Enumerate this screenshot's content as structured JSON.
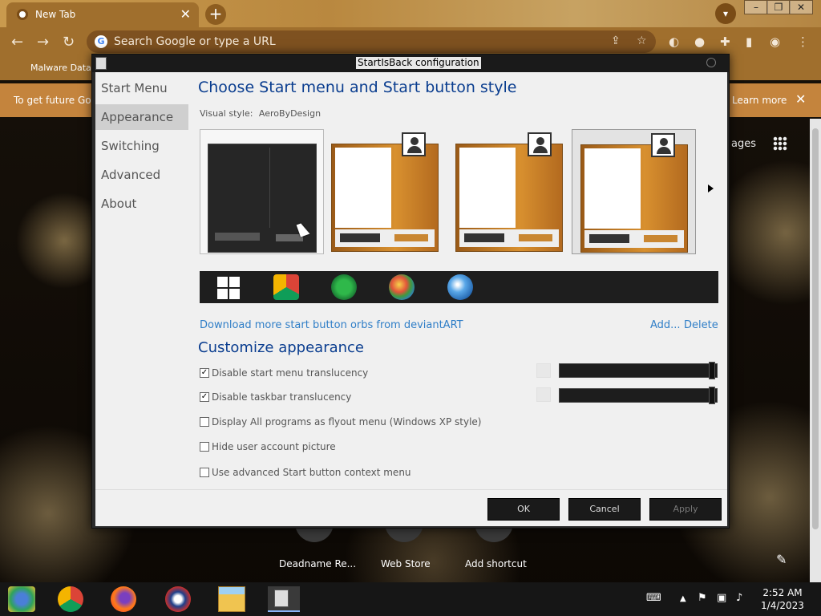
{
  "browser": {
    "tab_title": "New Tab",
    "tab_close": "✕",
    "new_tab": "+",
    "omnibox_placeholder": "Search Google or type a URL",
    "bookmark": "Malware Datab",
    "infobar_message": "To get future Go",
    "infobar_learn_more": "Learn more",
    "infobar_close": "✕",
    "ntp_link": "ages",
    "shortcuts": [
      "Deadname Re...",
      "Web Store",
      "Add shortcut"
    ]
  },
  "dialog": {
    "title": "StartIsBack configuration",
    "nav": [
      "Start Menu",
      "Appearance",
      "Switching",
      "Advanced",
      "About"
    ],
    "selected_nav": "Appearance",
    "heading_style": "Choose Start menu and Start button style",
    "visual_style_label": "Visual style:",
    "visual_style_value": "AeroByDesign",
    "download_link": "Download more start button orbs from deviantART",
    "add_link": "Add...",
    "delete_link": "Delete",
    "heading_customize": "Customize appearance",
    "options": [
      {
        "label": "Disable start menu translucency",
        "checked": true,
        "check": "✓"
      },
      {
        "label": "Disable taskbar translucency",
        "checked": true,
        "check": "✓"
      },
      {
        "label": "Display All programs as flyout menu (Windows XP style)",
        "checked": false,
        "check": ""
      },
      {
        "label": "Hide user account picture",
        "checked": false,
        "check": ""
      },
      {
        "label": "Use advanced Start button context menu",
        "checked": false,
        "check": ""
      }
    ],
    "buttons": {
      "ok": "OK",
      "cancel": "Cancel",
      "apply": "Apply"
    }
  },
  "taskbar": {
    "time": "2:52 AM",
    "date": "1/4/2023"
  },
  "colors": {
    "heading": "#0a3d8f",
    "link": "#2f7ec7",
    "orange_style": "#d8902f"
  }
}
